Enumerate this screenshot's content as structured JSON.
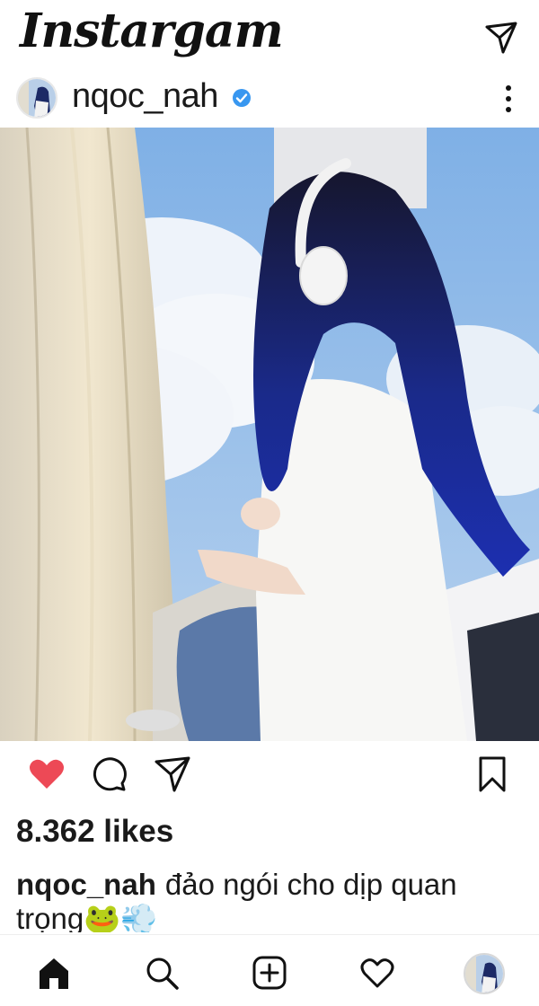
{
  "app": {
    "brand": "Instargam"
  },
  "post": {
    "username": "nqoc_nah",
    "verified": true,
    "likes": "8.362 likes",
    "caption_user": "nqoc_nah",
    "caption_text": "đảo ngói cho dịp quan trọng🐸💨",
    "liked": true
  },
  "icons": {
    "header": [
      "direct-message-icon"
    ],
    "post": [
      "verified-badge-icon",
      "more-options-icon"
    ],
    "actions": [
      "heart-filled-icon",
      "comment-icon",
      "share-icon",
      "bookmark-icon"
    ],
    "nav": [
      "home-icon",
      "search-icon",
      "new-post-icon",
      "activity-heart-icon",
      "profile-avatar"
    ]
  },
  "colors": {
    "like_red": "#ed4956",
    "verified_blue": "#3897f0",
    "text": "#1a1a1a"
  }
}
